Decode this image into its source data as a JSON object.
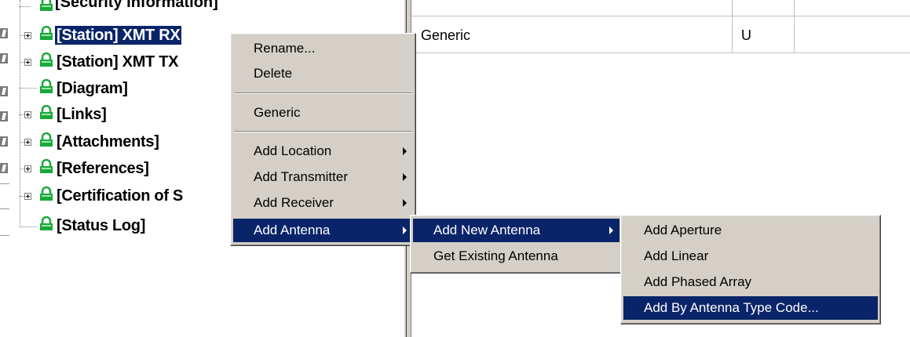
{
  "tree": {
    "items": [
      {
        "label": "[Security Information]"
      },
      {
        "label": "[Station] XMT RX"
      },
      {
        "label": "[Station] XMT TX"
      },
      {
        "label": "[Diagram]"
      },
      {
        "label": "[Links]"
      },
      {
        "label": "[Attachments]"
      },
      {
        "label": "[References]"
      },
      {
        "label": "[Certification of S"
      },
      {
        "label": "[Status Log]"
      }
    ]
  },
  "grid": {
    "row1": {
      "type": "Generic",
      "class": "U"
    }
  },
  "context_menu": {
    "items": [
      "Rename...",
      "Delete",
      "Generic",
      "Add Location",
      "Add Transmitter",
      "Add Receiver",
      "Add Antenna"
    ]
  },
  "antenna_menu": {
    "items": [
      "Add New Antenna",
      "Get Existing Antenna"
    ]
  },
  "new_antenna_menu": {
    "items": [
      "Add Aperture",
      "Add Linear",
      "Add Phased Array",
      "Add By Antenna Type Code..."
    ]
  },
  "colors": {
    "highlight": "#0a246a",
    "menu_bg": "#d4d0c8",
    "lock_green": "#1aa83a"
  }
}
